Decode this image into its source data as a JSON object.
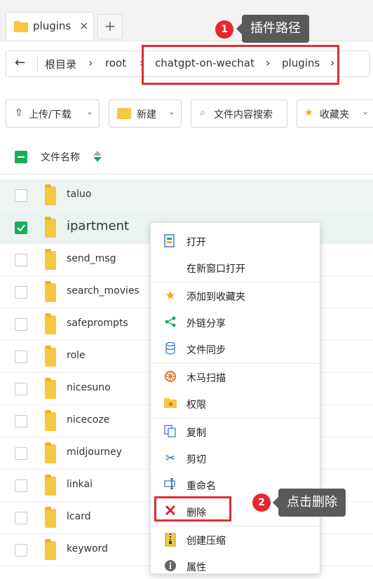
{
  "tab": {
    "label": "plugins",
    "close": "×",
    "new": "+"
  },
  "path": {
    "back": "←",
    "crumbs": [
      "根目录",
      "root",
      "chatgpt-on-wechat",
      "plugins"
    ],
    "sep": "›"
  },
  "toolbar": {
    "upload": "上传/下载",
    "new": "新建",
    "search": "文件内容搜索",
    "favorites": "收藏夹"
  },
  "header": {
    "name": "文件名称"
  },
  "files": [
    "taluo",
    "ipartment",
    "send_msg",
    "search_movies",
    "safeprompts",
    "role",
    "nicesuno",
    "nicecoze",
    "midjourney",
    "linkai",
    "lcard",
    "keyword"
  ],
  "menu": {
    "open": "打开",
    "open_new": "在新窗口打开",
    "add_fav": "添加到收藏夹",
    "share": "外链分享",
    "sync": "文件同步",
    "scan": "木马扫描",
    "perm": "权限",
    "copy": "复制",
    "cut": "剪切",
    "rename": "重命名",
    "delete": "删除",
    "compress": "创建压缩",
    "props": "属性"
  },
  "callouts": {
    "one": {
      "num": "1",
      "text": "插件路径"
    },
    "two": {
      "num": "2",
      "text": "点击删除"
    }
  },
  "colors": {
    "accent_green": "#1aad5a",
    "callout_red": "#e02b33",
    "folder_yellow": "#f4c842"
  }
}
